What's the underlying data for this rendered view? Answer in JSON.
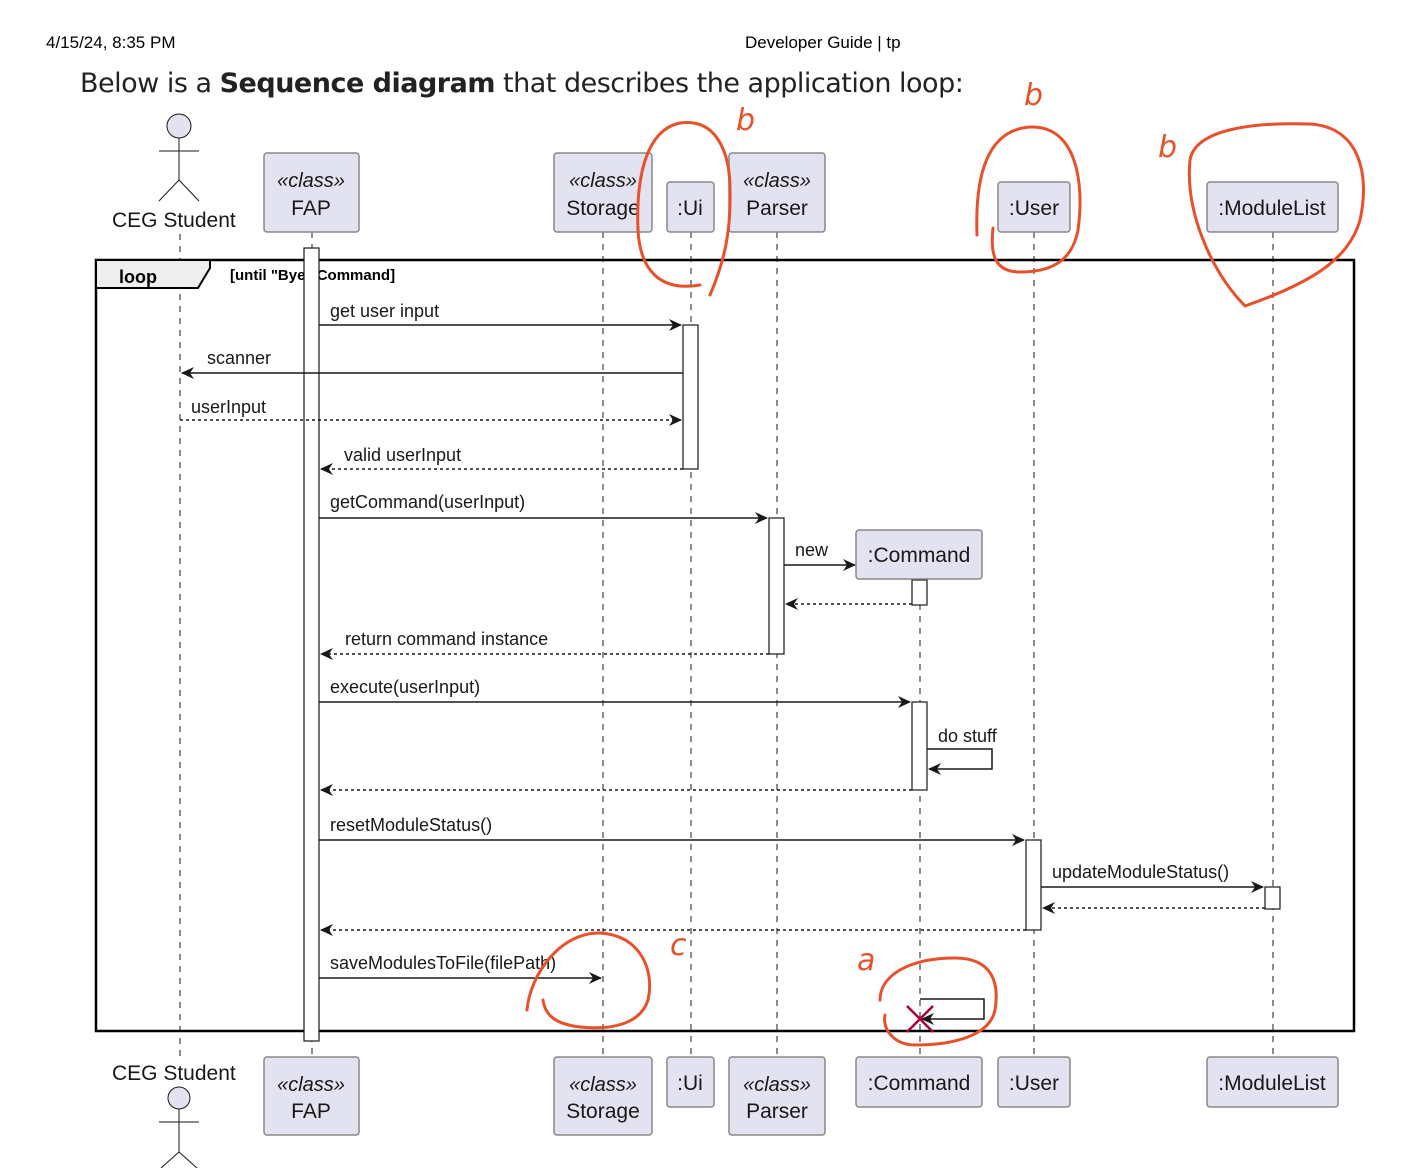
{
  "page_header": {
    "timestamp": "4/15/24, 8:35 PM",
    "title": "Developer Guide | tp"
  },
  "intro": {
    "prefix": "Below is a ",
    "bold": "Sequence diagram",
    "suffix": " that describes the application loop:"
  },
  "diagram": {
    "type": "sequence",
    "participants": [
      {
        "id": "student",
        "kind": "actor",
        "stereotype": "",
        "name": "CEG Student"
      },
      {
        "id": "fap",
        "kind": "class",
        "stereotype": "«class»",
        "name": "FAP"
      },
      {
        "id": "storage",
        "kind": "class",
        "stereotype": "«class»",
        "name": "Storage"
      },
      {
        "id": "ui",
        "kind": "object",
        "stereotype": "",
        "name": ":Ui"
      },
      {
        "id": "parser",
        "kind": "class",
        "stereotype": "«class»",
        "name": "Parser"
      },
      {
        "id": "command",
        "kind": "object",
        "stereotype": "",
        "name": ":Command"
      },
      {
        "id": "user",
        "kind": "object",
        "stereotype": "",
        "name": ":User"
      },
      {
        "id": "modulelist",
        "kind": "object",
        "stereotype": "",
        "name": ":ModuleList"
      }
    ],
    "loop": {
      "keyword": "loop",
      "condition": "[until \"Bye\" Command]"
    },
    "messages": [
      {
        "from": "fap",
        "to": "ui",
        "label": "get user input",
        "style": "sync"
      },
      {
        "from": "ui",
        "to": "student",
        "label": "scanner",
        "style": "sync"
      },
      {
        "from": "student",
        "to": "ui",
        "label": "userInput",
        "style": "return"
      },
      {
        "from": "ui",
        "to": "fap",
        "label": "valid userInput",
        "style": "return"
      },
      {
        "from": "fap",
        "to": "parser",
        "label": "getCommand(userInput)",
        "style": "sync"
      },
      {
        "from": "parser",
        "to": "command",
        "label": "new",
        "style": "create"
      },
      {
        "from": "command",
        "to": "parser",
        "label": "",
        "style": "return"
      },
      {
        "from": "parser",
        "to": "fap",
        "label": "return command instance",
        "style": "return"
      },
      {
        "from": "fap",
        "to": "command",
        "label": "execute(userInput)",
        "style": "sync"
      },
      {
        "from": "command",
        "to": "command",
        "label": "do stuff",
        "style": "self"
      },
      {
        "from": "command",
        "to": "fap",
        "label": "",
        "style": "return"
      },
      {
        "from": "fap",
        "to": "user",
        "label": "resetModuleStatus()",
        "style": "sync"
      },
      {
        "from": "user",
        "to": "modulelist",
        "label": "updateModuleStatus()",
        "style": "sync"
      },
      {
        "from": "modulelist",
        "to": "user",
        "label": "",
        "style": "return"
      },
      {
        "from": "user",
        "to": "fap",
        "label": "",
        "style": "return"
      },
      {
        "from": "fap",
        "to": "storage",
        "label": "saveModulesToFile(filePath)",
        "style": "sync"
      },
      {
        "from": "command",
        "to": "command",
        "label": "",
        "style": "self-destroy"
      }
    ],
    "destroy_marker_color": "#a80036"
  },
  "annotations": {
    "color": "#e8502a",
    "marks": [
      {
        "letter": "b",
        "target": ":Ui"
      },
      {
        "letter": "b",
        "target": ":User"
      },
      {
        "letter": "b",
        "target": ":ModuleList"
      },
      {
        "letter": "c",
        "target": "saveModulesToFile(filePath)"
      },
      {
        "letter": "a",
        "target": ":Command destroy"
      }
    ]
  }
}
